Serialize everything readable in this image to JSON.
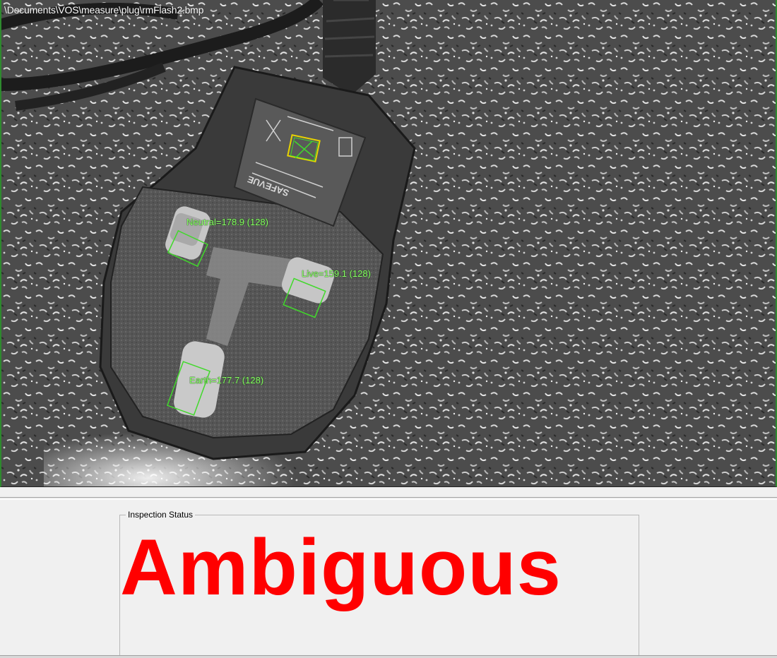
{
  "viewer": {
    "image_path": "\\Documents\\VOS\\measure\\plug\\rmFlash2.bmp",
    "roi_color": "#41d92b",
    "warning_roi_color": "#e8d400",
    "rois": [
      {
        "id": "neutral",
        "label": "Neutral=178.9 (128)"
      },
      {
        "id": "live",
        "label": "Live=159.1 (128)"
      },
      {
        "id": "earth",
        "label": "Earth=177.7 (128)"
      }
    ]
  },
  "inspection": {
    "group_title": "Inspection Status",
    "status": "Ambiguous",
    "status_color": "#ff0000"
  }
}
